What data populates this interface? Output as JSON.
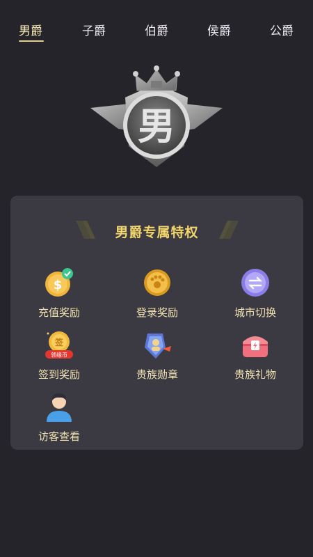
{
  "tabs": [
    {
      "label": "男爵",
      "active": true
    },
    {
      "label": "子爵",
      "active": false
    },
    {
      "label": "伯爵",
      "active": false
    },
    {
      "label": "侯爵",
      "active": false
    },
    {
      "label": "公爵",
      "active": false
    }
  ],
  "badge": {
    "emblem_text": "男"
  },
  "card": {
    "title": "男爵专属特权",
    "privileges": [
      {
        "label": "充值奖励",
        "icon": "coin-check-icon"
      },
      {
        "label": "登录奖励",
        "icon": "gold-coin-icon"
      },
      {
        "label": "城市切换",
        "icon": "switch-arrows-icon"
      },
      {
        "label": "签到奖励",
        "icon": "sign-in-coin-icon",
        "tag": "领缘币",
        "coin_text": "签"
      },
      {
        "label": "贵族勋章",
        "icon": "medal-icon"
      },
      {
        "label": "贵族礼物",
        "icon": "gift-chest-icon"
      },
      {
        "label": "访客查看",
        "icon": "visitor-avatar-icon"
      }
    ]
  },
  "colors": {
    "background": "#26242b",
    "card": "#3b3a42",
    "title_gold": "#f2d66b",
    "label_gold": "#f1e2b1",
    "tab_active": "#f6e7b1"
  }
}
